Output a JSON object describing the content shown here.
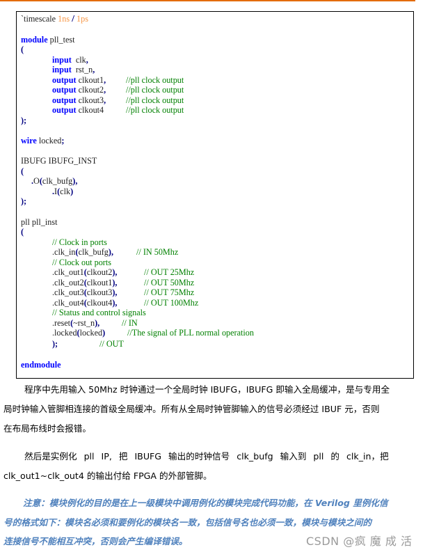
{
  "code": {
    "timescale": {
      "directive": "`timescale",
      "unit": "1ns",
      "slash": "/",
      "precision": "1ps"
    },
    "module_kw": "module",
    "module_name": "pll_test",
    "open_paren": "(",
    "ports": [
      {
        "kw": "input",
        "name": "clk",
        "punct": ",",
        "comment": ""
      },
      {
        "kw": "input",
        "name": "rst_n",
        "punct": ",",
        "comment": ""
      },
      {
        "kw": "output",
        "name": "clkout1",
        "punct": ",",
        "comment": "//pll clock output"
      },
      {
        "kw": "output",
        "name": "clkout2",
        "punct": ",",
        "comment": "//pll clock output"
      },
      {
        "kw": "output",
        "name": "clkout3",
        "punct": ",",
        "comment": "//pll clock output"
      },
      {
        "kw": "output",
        "name": "clkout4",
        "punct": "",
        "comment": "//pll clock output"
      }
    ],
    "close_semicolon": ");",
    "wire_kw": "wire",
    "wire_name": "locked",
    "semicolon": ";",
    "ibufg_decl": "IBUFG IBUFG_INST",
    "ibufg_o": {
      "port": ".O",
      "signal": "clk_bufg",
      "punct": ","
    },
    "ibufg_i": {
      "port": ".I",
      "signal": "clk",
      "punct": ""
    },
    "pll_decl": "pll pll_inst",
    "pll_lines": [
      {
        "type": "comment",
        "text": "// Clock in ports"
      },
      {
        "type": "conn",
        "port": ".clk_in",
        "signal": "clk_bufg",
        "punct": ",",
        "comment": "// IN 50Mhz"
      },
      {
        "type": "comment",
        "text": "// Clock out ports"
      },
      {
        "type": "conn",
        "port": ".clk_out1",
        "signal": "clkout2",
        "punct": ",",
        "comment": "// OUT 25Mhz"
      },
      {
        "type": "conn",
        "port": ".clk_out2",
        "signal": "clkout1",
        "punct": ",",
        "comment": "// OUT 50Mhz"
      },
      {
        "type": "conn",
        "port": ".clk_out3",
        "signal": "clkout3",
        "punct": ",",
        "comment": "// OUT 75Mhz"
      },
      {
        "type": "conn",
        "port": ".clk_out4",
        "signal": "clkout4",
        "punct": ",",
        "comment": "// OUT 100Mhz"
      },
      {
        "type": "comment",
        "text": "// Status and control signals"
      },
      {
        "type": "conn",
        "port": ".reset",
        "signal": "~rst_n",
        "punct": ",",
        "comment": "// IN"
      },
      {
        "type": "conn",
        "port": ".locked",
        "signal": "locked",
        "punct": "",
        "comment": "//The signal of PLL normal operation"
      }
    ],
    "pll_close": ");",
    "pll_close_comment": "// OUT",
    "endmodule_kw": "endmodule"
  },
  "paragraphs": {
    "p1_line1": "程序中先用输入 50Mhz 时钟通过一个全局时钟 IBUFG，IBUFG 即输入全局缓冲，是与专用全",
    "p1_line2": "局时钟输入管脚相连接的首级全局缓冲。所有从全局时钟管脚输入的信号必须经过 IBUF 元，否则",
    "p1_line3": "在布局布线时会报错。",
    "p2_line1": "然后是实例化 pll IP, 把 IBUFG 输出的时钟信号 clk_bufg 输入到 pll 的 clk_in，把",
    "p2_line2": "clk_out1~clk_out4 的输出付给 FPGA 的外部管脚。",
    "note_line1": "注意：模块例化的目的是在上一级模块中调用例化的模块完成代码功能，在 Verilog 里例化信",
    "note_line2": "号的格式如下：模块名必须和要例化的模块名一致，包括信号名也必须一致，模块与模块之间的",
    "note_line3": "连接信号不能相互冲突，否则会产生编译错误。"
  },
  "watermark": "CSDN @疯 魔 成 活",
  "colors": {
    "accent_line": "#e36c0a",
    "keyword": "#0000ff",
    "comment": "#008000",
    "number": "#f79646",
    "note": "#4f81bd"
  }
}
